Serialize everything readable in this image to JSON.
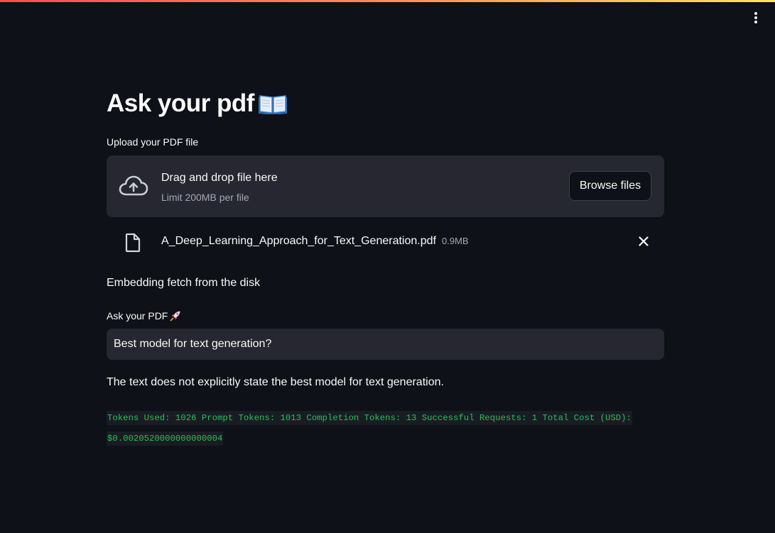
{
  "app": {
    "title": "Ask your pdf",
    "title_icon": "open-book-icon",
    "menu_icon": "vertical-ellipsis-icon",
    "accent_gradient": [
      "#ff4b4b",
      "#ffe45c"
    ]
  },
  "uploader": {
    "label": "Upload your PDF file",
    "dropzone_title": "Drag and drop file here",
    "dropzone_limit": "Limit 200MB per file",
    "browse_label": "Browse files",
    "icon": "cloud-upload-icon"
  },
  "uploaded_file": {
    "name": "A_Deep_Learning_Approach_for_Text_Generation.pdf",
    "size": "0.9MB",
    "icon": "file-icon",
    "remove_icon": "close-icon"
  },
  "status": {
    "embedding": "Embedding fetch from the disk"
  },
  "question": {
    "label": "Ask your PDF",
    "label_icon": "rocket-icon",
    "value": "Best model for text generation?"
  },
  "answer": {
    "text": "The text does not explicitly state the best model for text generation."
  },
  "usage": {
    "text": "Tokens Used: 1026 Prompt Tokens: 1013 Completion Tokens: 13 Successful Requests: 1 Total Cost (USD): $0.0020520000000000004",
    "color": "#21c354"
  },
  "colors": {
    "background": "#0e1117",
    "surface": "#262730",
    "text": "#fafafa",
    "muted": "#a3a8b8"
  }
}
